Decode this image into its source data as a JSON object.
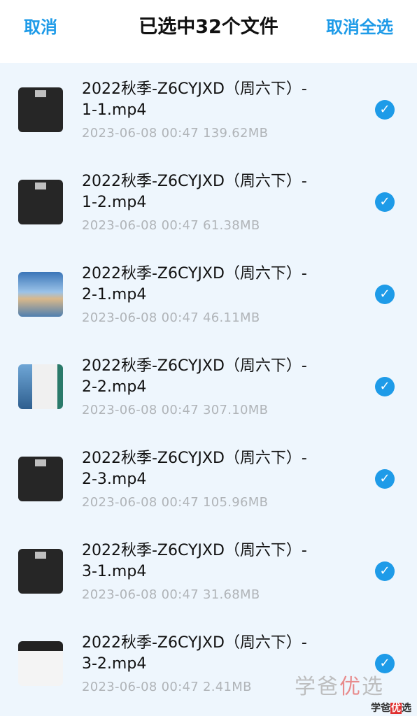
{
  "header": {
    "cancel_label": "取消",
    "title": "已选中32个文件",
    "deselect_all_label": "取消全选"
  },
  "files": [
    {
      "name_line1": "2022秋季-Z6CYJXD（周六下）-",
      "name_line2": "1-1.mp4",
      "meta": "2023-06-08  00:47  139.62MB",
      "selected": true
    },
    {
      "name_line1": "2022秋季-Z6CYJXD（周六下）-",
      "name_line2": "1-2.mp4",
      "meta": "2023-06-08  00:47  61.38MB",
      "selected": true
    },
    {
      "name_line1": "2022秋季-Z6CYJXD（周六下）-",
      "name_line2": "2-1.mp4",
      "meta": "2023-06-08  00:47  46.11MB",
      "selected": true
    },
    {
      "name_line1": "2022秋季-Z6CYJXD（周六下）-",
      "name_line2": "2-2.mp4",
      "meta": "2023-06-08  00:47  307.10MB",
      "selected": true
    },
    {
      "name_line1": "2022秋季-Z6CYJXD（周六下）-",
      "name_line2": "2-3.mp4",
      "meta": "2023-06-08  00:47  105.96MB",
      "selected": true
    },
    {
      "name_line1": "2022秋季-Z6CYJXD（周六下）-",
      "name_line2": "3-1.mp4",
      "meta": "2023-06-08  00:47  31.68MB",
      "selected": true
    },
    {
      "name_line1": "2022秋季-Z6CYJXD（周六下）-",
      "name_line2": "3-2.mp4",
      "meta": "2023-06-08  00:47  2.41MB",
      "selected": true
    }
  ],
  "check_glyph": "✓",
  "watermark": {
    "part1": "学爸",
    "part2": "优",
    "part3": "选"
  },
  "watermark_small": {
    "part1": "学爸",
    "part2": "优",
    "part3": "选"
  },
  "colors": {
    "accent": "#1e9be8",
    "background": "#eef6fd",
    "meta_text": "#b0b4b8"
  }
}
